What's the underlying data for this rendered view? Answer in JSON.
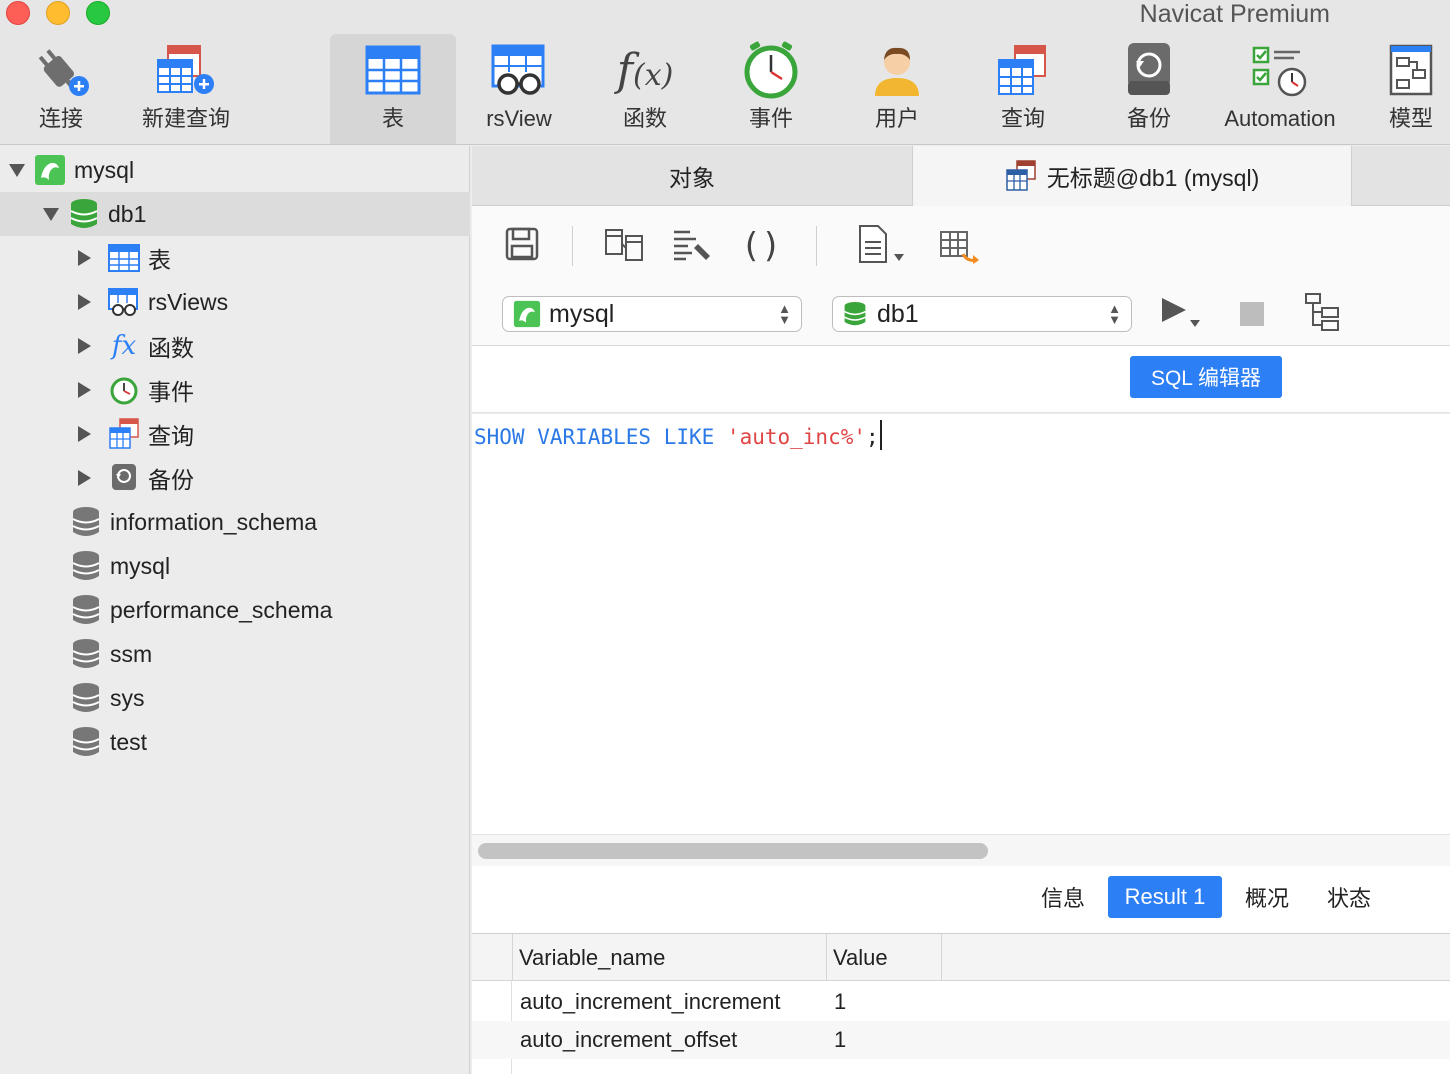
{
  "window": {
    "title": "Navicat Premium"
  },
  "toolbar": {
    "items": [
      {
        "label": "连接",
        "icon": "plug-icon"
      },
      {
        "label": "新建查询",
        "icon": "new-query-icon"
      },
      {
        "label": "表",
        "icon": "table-icon",
        "active": true
      },
      {
        "label": "rsView",
        "icon": "view-icon"
      },
      {
        "label": "函数",
        "icon": "function-icon"
      },
      {
        "label": "事件",
        "icon": "clock-icon"
      },
      {
        "label": "用户",
        "icon": "user-icon"
      },
      {
        "label": "查询",
        "icon": "query-icon"
      },
      {
        "label": "备份",
        "icon": "backup-icon"
      },
      {
        "label": "Automation",
        "icon": "automation-icon"
      },
      {
        "label": "模型",
        "icon": "model-icon"
      }
    ]
  },
  "sidebar": {
    "connection": "mysql",
    "database": "db1",
    "db_children": [
      {
        "label": "表",
        "icon": "table-icon"
      },
      {
        "label": "rsViews",
        "icon": "view-icon"
      },
      {
        "label": "函数",
        "icon": "function-icon"
      },
      {
        "label": "事件",
        "icon": "clock-icon"
      },
      {
        "label": "查询",
        "icon": "query-icon"
      },
      {
        "label": "备份",
        "icon": "backup-icon"
      }
    ],
    "other_databases": [
      "information_schema",
      "mysql",
      "performance_schema",
      "ssm",
      "sys",
      "test"
    ]
  },
  "tabs": {
    "objects": "对象",
    "query": "无标题@db1 (mysql)"
  },
  "editor_toolbar": {
    "connection_select": "mysql",
    "database_select": "db1",
    "mode_badge": "SQL 编辑器"
  },
  "editor": {
    "kw1": "SHOW",
    "kw2": "VARIABLES",
    "kw3": "LIKE",
    "str": "'auto_inc%'",
    "end": ";"
  },
  "result_tabs": {
    "info": "信息",
    "result": "Result 1",
    "overview": "概况",
    "status": "状态"
  },
  "grid": {
    "columns": [
      "Variable_name",
      "Value"
    ],
    "rows": [
      [
        "auto_increment_increment",
        "1"
      ],
      [
        "auto_increment_offset",
        "1"
      ]
    ]
  },
  "colors": {
    "accent": "#2d7ff5",
    "keyword": "#2a79e6",
    "string": "#e04545",
    "db_green": "#3aa53a"
  }
}
